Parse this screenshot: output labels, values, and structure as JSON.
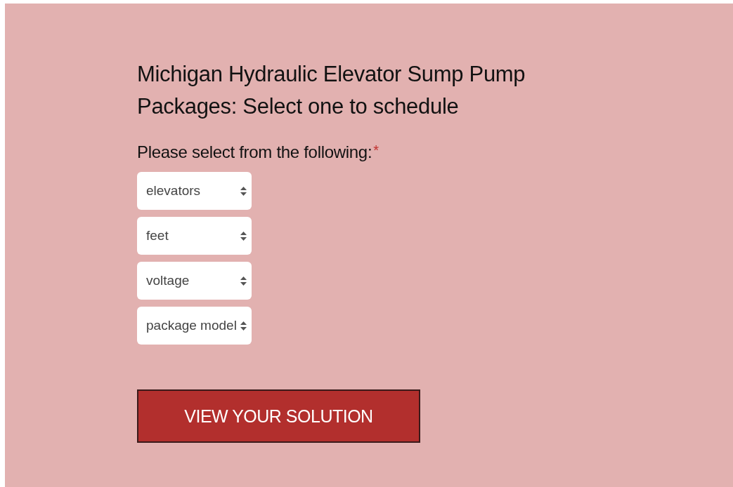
{
  "heading": "Michigan Hydraulic Elevator Sump Pump Packages: Select one to schedule",
  "form": {
    "label": "Please select from the following:",
    "required_mark": "*",
    "selects": [
      {
        "value": "elevators"
      },
      {
        "value": "feet"
      },
      {
        "value": "voltage"
      },
      {
        "value": "package model"
      }
    ],
    "submit": "VIEW YOUR SOLUTION"
  }
}
